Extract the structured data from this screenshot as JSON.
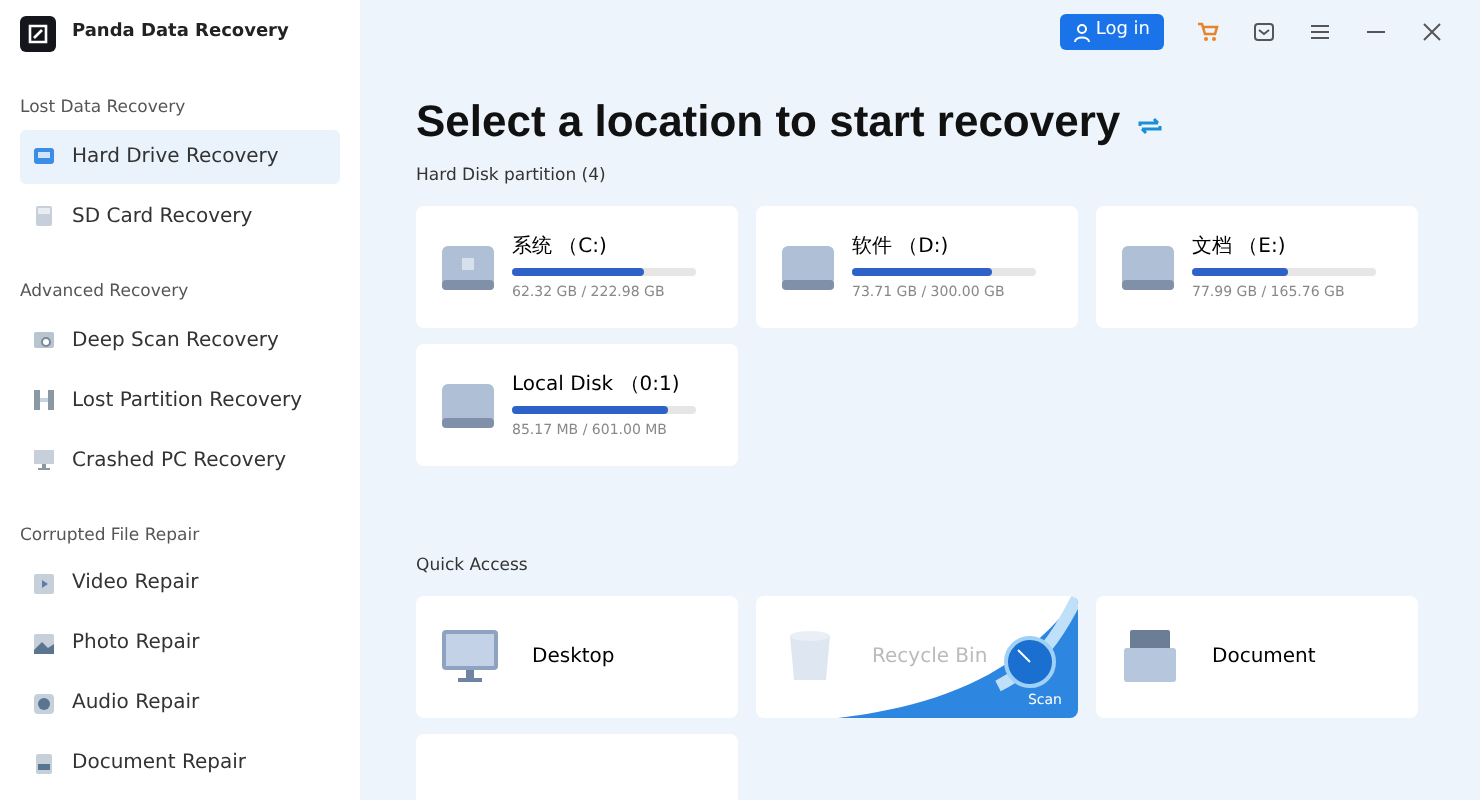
{
  "app": {
    "title": "Panda Data Recovery"
  },
  "toolbar": {
    "login": "Log in"
  },
  "sidebar": [
    {
      "heading": "Lost Data Recovery",
      "items": [
        {
          "label": "Hard Drive Recovery",
          "selected": true
        },
        {
          "label": "SD Card Recovery",
          "selected": false
        }
      ]
    },
    {
      "heading": "Advanced Recovery",
      "items": [
        {
          "label": "Deep Scan Recovery",
          "selected": false
        },
        {
          "label": "Lost Partition Recovery",
          "selected": false
        },
        {
          "label": "Crashed PC Recovery",
          "selected": false
        }
      ]
    },
    {
      "heading": "Corrupted File Repair",
      "items": [
        {
          "label": "Video Repair",
          "selected": false
        },
        {
          "label": "Photo Repair",
          "selected": false
        },
        {
          "label": "Audio Repair",
          "selected": false
        },
        {
          "label": "Document Repair",
          "selected": false
        }
      ]
    }
  ],
  "heading": "Select a location to start recovery",
  "partitions": {
    "title": "Hard Disk partition (4)",
    "drives": [
      {
        "name": "系统 （C:)",
        "level": 0.72,
        "usage": "62.32 GB / 222.98 GB",
        "system": true
      },
      {
        "name": "软件 （D:)",
        "level": 0.76,
        "usage": "73.71 GB / 300.00 GB",
        "system": false
      },
      {
        "name": "文档 （E:)",
        "level": 0.52,
        "usage": "77.99 GB / 165.76 GB",
        "system": false
      },
      {
        "name": "Local Disk （0:1)",
        "level": 0.85,
        "usage": "85.17 MB / 601.00 MB",
        "system": false
      }
    ]
  },
  "quick_access": {
    "title": "Quick Access",
    "items": [
      {
        "kind": "desktop",
        "label": "Desktop",
        "hovered": false
      },
      {
        "kind": "recycle",
        "label": "Recycle Bin",
        "hovered": true,
        "action": "Scan"
      },
      {
        "kind": "document",
        "label": "Document",
        "hovered": false
      }
    ]
  }
}
